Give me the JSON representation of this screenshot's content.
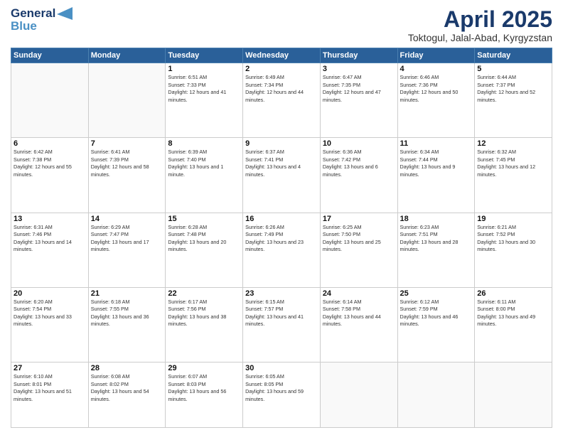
{
  "header": {
    "logo_line1": "General",
    "logo_line2": "Blue",
    "title": "April 2025",
    "subtitle": "Toktogul, Jalal-Abad, Kyrgyzstan"
  },
  "days_of_week": [
    "Sunday",
    "Monday",
    "Tuesday",
    "Wednesday",
    "Thursday",
    "Friday",
    "Saturday"
  ],
  "weeks": [
    [
      {
        "day": "",
        "info": ""
      },
      {
        "day": "",
        "info": ""
      },
      {
        "day": "1",
        "info": "Sunrise: 6:51 AM\nSunset: 7:33 PM\nDaylight: 12 hours and 41 minutes."
      },
      {
        "day": "2",
        "info": "Sunrise: 6:49 AM\nSunset: 7:34 PM\nDaylight: 12 hours and 44 minutes."
      },
      {
        "day": "3",
        "info": "Sunrise: 6:47 AM\nSunset: 7:35 PM\nDaylight: 12 hours and 47 minutes."
      },
      {
        "day": "4",
        "info": "Sunrise: 6:46 AM\nSunset: 7:36 PM\nDaylight: 12 hours and 50 minutes."
      },
      {
        "day": "5",
        "info": "Sunrise: 6:44 AM\nSunset: 7:37 PM\nDaylight: 12 hours and 52 minutes."
      }
    ],
    [
      {
        "day": "6",
        "info": "Sunrise: 6:42 AM\nSunset: 7:38 PM\nDaylight: 12 hours and 55 minutes."
      },
      {
        "day": "7",
        "info": "Sunrise: 6:41 AM\nSunset: 7:39 PM\nDaylight: 12 hours and 58 minutes."
      },
      {
        "day": "8",
        "info": "Sunrise: 6:39 AM\nSunset: 7:40 PM\nDaylight: 13 hours and 1 minute."
      },
      {
        "day": "9",
        "info": "Sunrise: 6:37 AM\nSunset: 7:41 PM\nDaylight: 13 hours and 4 minutes."
      },
      {
        "day": "10",
        "info": "Sunrise: 6:36 AM\nSunset: 7:42 PM\nDaylight: 13 hours and 6 minutes."
      },
      {
        "day": "11",
        "info": "Sunrise: 6:34 AM\nSunset: 7:44 PM\nDaylight: 13 hours and 9 minutes."
      },
      {
        "day": "12",
        "info": "Sunrise: 6:32 AM\nSunset: 7:45 PM\nDaylight: 13 hours and 12 minutes."
      }
    ],
    [
      {
        "day": "13",
        "info": "Sunrise: 6:31 AM\nSunset: 7:46 PM\nDaylight: 13 hours and 14 minutes."
      },
      {
        "day": "14",
        "info": "Sunrise: 6:29 AM\nSunset: 7:47 PM\nDaylight: 13 hours and 17 minutes."
      },
      {
        "day": "15",
        "info": "Sunrise: 6:28 AM\nSunset: 7:48 PM\nDaylight: 13 hours and 20 minutes."
      },
      {
        "day": "16",
        "info": "Sunrise: 6:26 AM\nSunset: 7:49 PM\nDaylight: 13 hours and 23 minutes."
      },
      {
        "day": "17",
        "info": "Sunrise: 6:25 AM\nSunset: 7:50 PM\nDaylight: 13 hours and 25 minutes."
      },
      {
        "day": "18",
        "info": "Sunrise: 6:23 AM\nSunset: 7:51 PM\nDaylight: 13 hours and 28 minutes."
      },
      {
        "day": "19",
        "info": "Sunrise: 6:21 AM\nSunset: 7:52 PM\nDaylight: 13 hours and 30 minutes."
      }
    ],
    [
      {
        "day": "20",
        "info": "Sunrise: 6:20 AM\nSunset: 7:54 PM\nDaylight: 13 hours and 33 minutes."
      },
      {
        "day": "21",
        "info": "Sunrise: 6:18 AM\nSunset: 7:55 PM\nDaylight: 13 hours and 36 minutes."
      },
      {
        "day": "22",
        "info": "Sunrise: 6:17 AM\nSunset: 7:56 PM\nDaylight: 13 hours and 38 minutes."
      },
      {
        "day": "23",
        "info": "Sunrise: 6:15 AM\nSunset: 7:57 PM\nDaylight: 13 hours and 41 minutes."
      },
      {
        "day": "24",
        "info": "Sunrise: 6:14 AM\nSunset: 7:58 PM\nDaylight: 13 hours and 44 minutes."
      },
      {
        "day": "25",
        "info": "Sunrise: 6:12 AM\nSunset: 7:59 PM\nDaylight: 13 hours and 46 minutes."
      },
      {
        "day": "26",
        "info": "Sunrise: 6:11 AM\nSunset: 8:00 PM\nDaylight: 13 hours and 49 minutes."
      }
    ],
    [
      {
        "day": "27",
        "info": "Sunrise: 6:10 AM\nSunset: 8:01 PM\nDaylight: 13 hours and 51 minutes."
      },
      {
        "day": "28",
        "info": "Sunrise: 6:08 AM\nSunset: 8:02 PM\nDaylight: 13 hours and 54 minutes."
      },
      {
        "day": "29",
        "info": "Sunrise: 6:07 AM\nSunset: 8:03 PM\nDaylight: 13 hours and 56 minutes."
      },
      {
        "day": "30",
        "info": "Sunrise: 6:05 AM\nSunset: 8:05 PM\nDaylight: 13 hours and 59 minutes."
      },
      {
        "day": "",
        "info": ""
      },
      {
        "day": "",
        "info": ""
      },
      {
        "day": "",
        "info": ""
      }
    ]
  ]
}
